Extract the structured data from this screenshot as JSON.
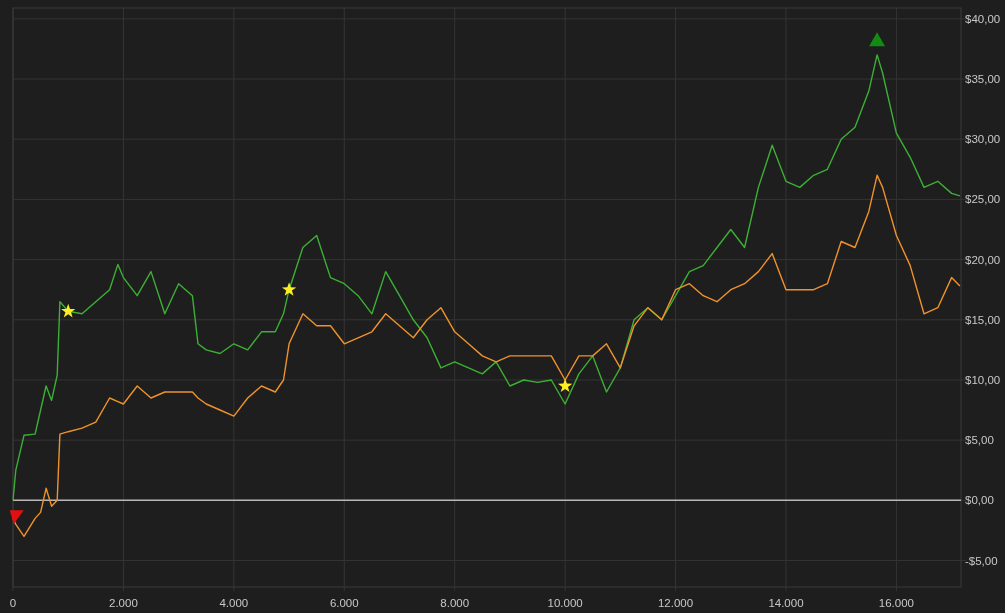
{
  "chart_data": {
    "type": "line",
    "grid": true,
    "x": [
      0,
      50,
      200,
      400,
      500,
      600,
      700,
      800,
      850,
      1000,
      1250,
      1500,
      1750,
      1900,
      2000,
      2250,
      2500,
      2750,
      3000,
      3250,
      3350,
      3500,
      3750,
      4000,
      4250,
      4500,
      4750,
      4900,
      5000,
      5250,
      5500,
      5750,
      6000,
      6250,
      6500,
      6750,
      7000,
      7250,
      7500,
      7750,
      8000,
      8250,
      8500,
      8750,
      9000,
      9250,
      9500,
      9750,
      10000,
      10250,
      10500,
      10750,
      11000,
      11250,
      11500,
      11750,
      12000,
      12250,
      12500,
      12750,
      13000,
      13250,
      13500,
      13750,
      14000,
      14250,
      14500,
      14750,
      15000,
      15250,
      15500,
      15650,
      15750,
      16000,
      16250,
      16500,
      16750,
      17000,
      17150
    ],
    "series": [
      {
        "color": "#3cb034",
        "values": [
          0,
          2.5,
          5.4,
          5.5,
          7.5,
          9.5,
          8.3,
          10.4,
          16.5,
          15.7,
          15.5,
          16.5,
          17.5,
          19.6,
          18.5,
          17,
          19,
          15.5,
          18,
          17,
          13,
          12.5,
          12.2,
          13,
          12.5,
          14,
          14,
          15.5,
          17.5,
          21,
          22,
          18.5,
          18,
          17,
          15.5,
          19,
          17,
          15,
          13.5,
          11,
          11.5,
          11,
          10.5,
          11.5,
          9.5,
          10,
          9.8,
          10,
          8,
          10.5,
          12,
          9,
          11,
          15,
          16,
          15,
          17,
          19,
          19.5,
          21,
          22.5,
          21,
          26,
          29.5,
          26.5,
          26,
          27,
          27.5,
          30,
          31,
          34,
          37,
          35.5,
          30.5,
          28.5,
          26,
          26.5,
          25.5,
          25.3
        ]
      },
      {
        "color": "#f0922c",
        "values": [
          -1.5,
          -2,
          -3,
          -1.5,
          -1,
          1,
          -0.5,
          0,
          5.5,
          5.7,
          6,
          6.5,
          8.5,
          8.2,
          8,
          9.5,
          8.5,
          9,
          9,
          9,
          8.5,
          8,
          7.5,
          7,
          8.5,
          9.5,
          9,
          10,
          13,
          15.5,
          14.5,
          14.5,
          13,
          13.5,
          14,
          15.5,
          14.5,
          13.5,
          15,
          16,
          14,
          13,
          12,
          11.5,
          12,
          12,
          12,
          12,
          10,
          12,
          12,
          13,
          11,
          14.5,
          16,
          15,
          17.5,
          18,
          17,
          16.5,
          17.5,
          18,
          19,
          20.5,
          17.5,
          17.5,
          17.5,
          18,
          21.5,
          21,
          24,
          27,
          26,
          22,
          19.5,
          15.5,
          16,
          18.5,
          17.8
        ]
      },
      {
        "color": "#ffee20",
        "marker": "star",
        "values": [
          null,
          null,
          null,
          null,
          null,
          null,
          null,
          null,
          null,
          15.7,
          null,
          null,
          null,
          null,
          null,
          null,
          null,
          null,
          null,
          null,
          null,
          null,
          null,
          null,
          null,
          null,
          null,
          null,
          null,
          null,
          null,
          null,
          null,
          null,
          null,
          null,
          null,
          null,
          null,
          null,
          null,
          null,
          null,
          null,
          null,
          null,
          null,
          null,
          null,
          null,
          null,
          null,
          null,
          null,
          null,
          null,
          null,
          null,
          null,
          null,
          null,
          null,
          null,
          null,
          null,
          null,
          null,
          null,
          null,
          null,
          null,
          null,
          null,
          null,
          null,
          null,
          null,
          null,
          null
        ]
      },
      {
        "color": "#ffee20",
        "marker": "star",
        "values": [
          null,
          null,
          null,
          null,
          null,
          null,
          null,
          null,
          null,
          null,
          null,
          null,
          null,
          null,
          null,
          null,
          null,
          null,
          null,
          null,
          null,
          null,
          null,
          null,
          null,
          null,
          null,
          null,
          17.5,
          null,
          null,
          null,
          null,
          null,
          null,
          null,
          null,
          null,
          null,
          null,
          null,
          null,
          null,
          null,
          null,
          null,
          null,
          null,
          null,
          null,
          null,
          null,
          null,
          null,
          null,
          null,
          null,
          null,
          null,
          null,
          null,
          null,
          null,
          null,
          null,
          null,
          null,
          null,
          null,
          null,
          null,
          null,
          null,
          null,
          null,
          null,
          null,
          null,
          null
        ]
      },
      {
        "color": "#ffee20",
        "marker": "star",
        "values": [
          null,
          null,
          null,
          null,
          null,
          null,
          null,
          null,
          null,
          null,
          null,
          null,
          null,
          null,
          null,
          null,
          null,
          null,
          null,
          null,
          null,
          null,
          null,
          null,
          null,
          null,
          null,
          null,
          null,
          null,
          null,
          null,
          null,
          null,
          null,
          null,
          null,
          null,
          null,
          null,
          null,
          null,
          null,
          null,
          null,
          null,
          null,
          null,
          9.5,
          null,
          null,
          null,
          null,
          null,
          null,
          null,
          null,
          null,
          null,
          null,
          null,
          null,
          null,
          null,
          null,
          null,
          null,
          null,
          null,
          null,
          null,
          null,
          null,
          null,
          null,
          null,
          null,
          null,
          null
        ]
      },
      {
        "color": "#138a13",
        "marker": "triangle",
        "values": [
          null,
          null,
          null,
          null,
          null,
          null,
          null,
          null,
          null,
          null,
          null,
          null,
          null,
          null,
          null,
          null,
          null,
          null,
          null,
          null,
          null,
          null,
          null,
          null,
          null,
          null,
          null,
          null,
          null,
          null,
          null,
          null,
          null,
          null,
          null,
          null,
          null,
          null,
          null,
          null,
          null,
          null,
          null,
          null,
          null,
          null,
          null,
          null,
          null,
          null,
          null,
          null,
          null,
          null,
          null,
          null,
          null,
          null,
          null,
          null,
          null,
          null,
          null,
          null,
          null,
          null,
          null,
          null,
          null,
          null,
          null,
          38.3,
          null,
          null,
          null,
          null,
          null,
          null,
          null
        ]
      },
      {
        "color": "#e01010",
        "marker": "triangle",
        "values": [
          null,
          -1.4,
          null,
          null,
          null,
          null,
          null,
          null,
          null,
          null,
          null,
          null,
          null,
          null,
          null,
          null,
          null,
          null,
          null,
          null,
          null,
          null,
          null,
          null,
          null,
          null,
          null,
          null,
          null,
          null,
          null,
          null,
          null,
          null,
          null,
          null,
          null,
          null,
          null,
          null,
          null,
          null,
          null,
          null,
          null,
          null,
          null,
          null,
          null,
          null,
          null,
          null,
          null,
          null,
          null,
          null,
          null,
          null,
          null,
          null,
          null,
          null,
          null,
          null,
          null,
          null,
          null,
          null,
          null,
          null,
          null,
          null,
          null,
          null,
          null,
          null,
          null,
          null,
          null
        ]
      }
    ],
    "xlim": [
      0,
      17170
    ],
    "ylim": [
      -7.2,
      40.9
    ],
    "xticks": [
      {
        "value": 0,
        "label": "0"
      },
      {
        "value": 2000,
        "label": "2.000"
      },
      {
        "value": 4000,
        "label": "4.000"
      },
      {
        "value": 6000,
        "label": "6.000"
      },
      {
        "value": 8000,
        "label": "8.000"
      },
      {
        "value": 10000,
        "label": "10.000"
      },
      {
        "value": 12000,
        "label": "12.000"
      },
      {
        "value": 14000,
        "label": "14.000"
      },
      {
        "value": 16000,
        "label": "16.000"
      }
    ],
    "yticks": [
      {
        "value": 40,
        "label": "$40,00"
      },
      {
        "value": 35,
        "label": "$35,00"
      },
      {
        "value": 30,
        "label": "$30,00"
      },
      {
        "value": 25,
        "label": "$25,00"
      },
      {
        "value": 20,
        "label": "$20,00"
      },
      {
        "value": 15,
        "label": "$15,00"
      },
      {
        "value": 10,
        "label": "$10,00"
      },
      {
        "value": 5,
        "label": "$5,00"
      },
      {
        "value": 0,
        "label": "$0,00"
      },
      {
        "value": -5,
        "label": "-$5,00"
      }
    ]
  }
}
